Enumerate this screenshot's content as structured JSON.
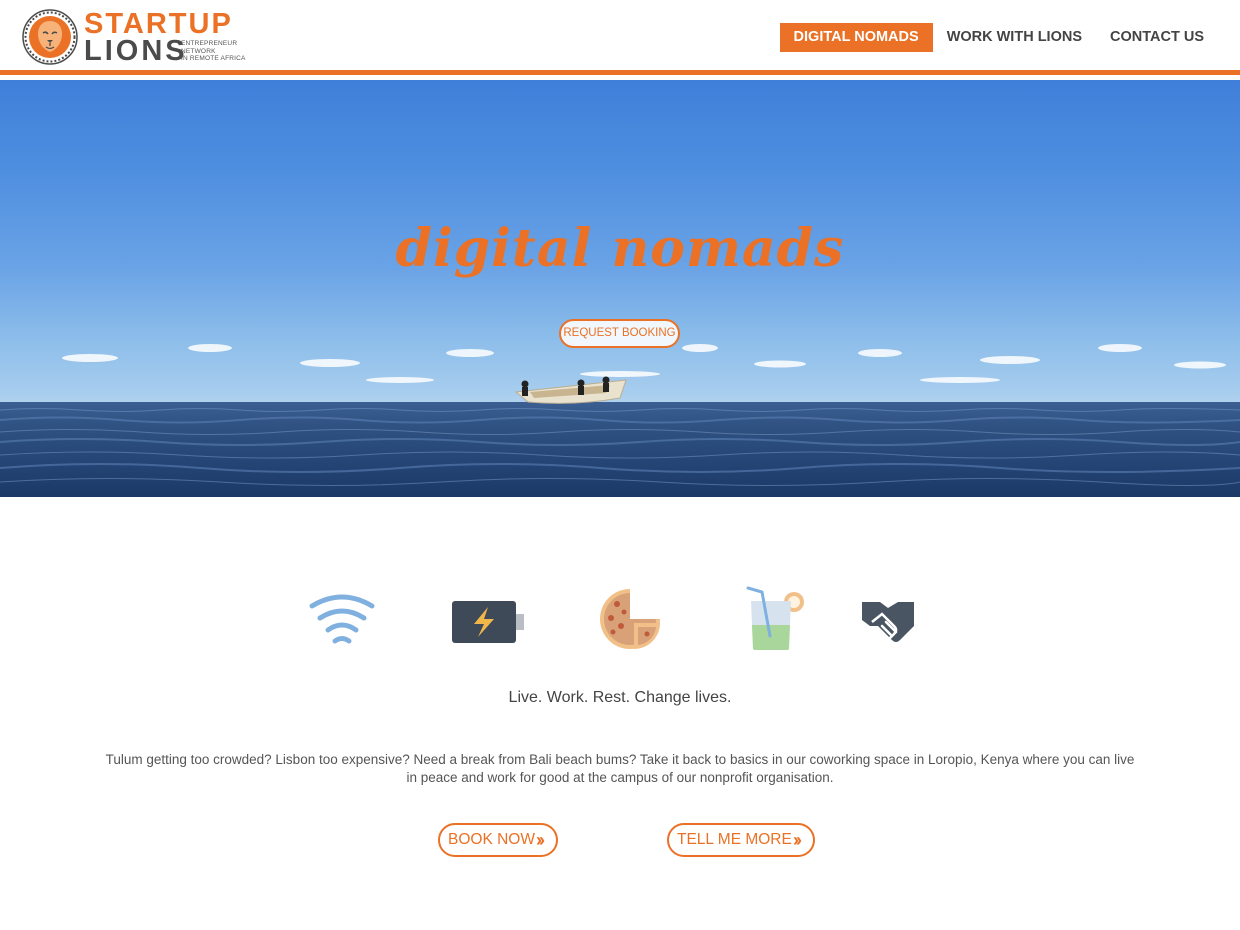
{
  "brand": {
    "name_top": "STARTUP",
    "name_bottom": "LIONS",
    "tagline_lines": [
      "ENTREPRENEUR",
      "NETWORK",
      "IN REMOTE AFRICA"
    ],
    "colors": {
      "accent": "#ea7125",
      "dark": "#4b4b4b"
    }
  },
  "nav": {
    "items": [
      {
        "label": "DIGITAL NOMADS",
        "active": true
      },
      {
        "label": "WORK WITH LIONS",
        "active": false
      },
      {
        "label": "CONTACT US",
        "active": false
      }
    ]
  },
  "hero": {
    "title": "digital nomads",
    "button_label": "REQUEST BOOKING"
  },
  "features": {
    "icons": [
      "wifi-icon",
      "battery-charging-icon",
      "pizza-icon",
      "drink-icon",
      "handshake-icon"
    ]
  },
  "tagline": "Live. Work. Rest. Change lives.",
  "description": "Tulum getting too crowded? Lisbon too expensive? Need a break from Bali beach bums? Take it back to basics in our coworking space in Loropio, Kenya where you can live in peace and work for good at the campus of our nonprofit organisation.",
  "cta": {
    "book_label": "BOOK NOW",
    "tell_label": "TELL ME MORE"
  }
}
